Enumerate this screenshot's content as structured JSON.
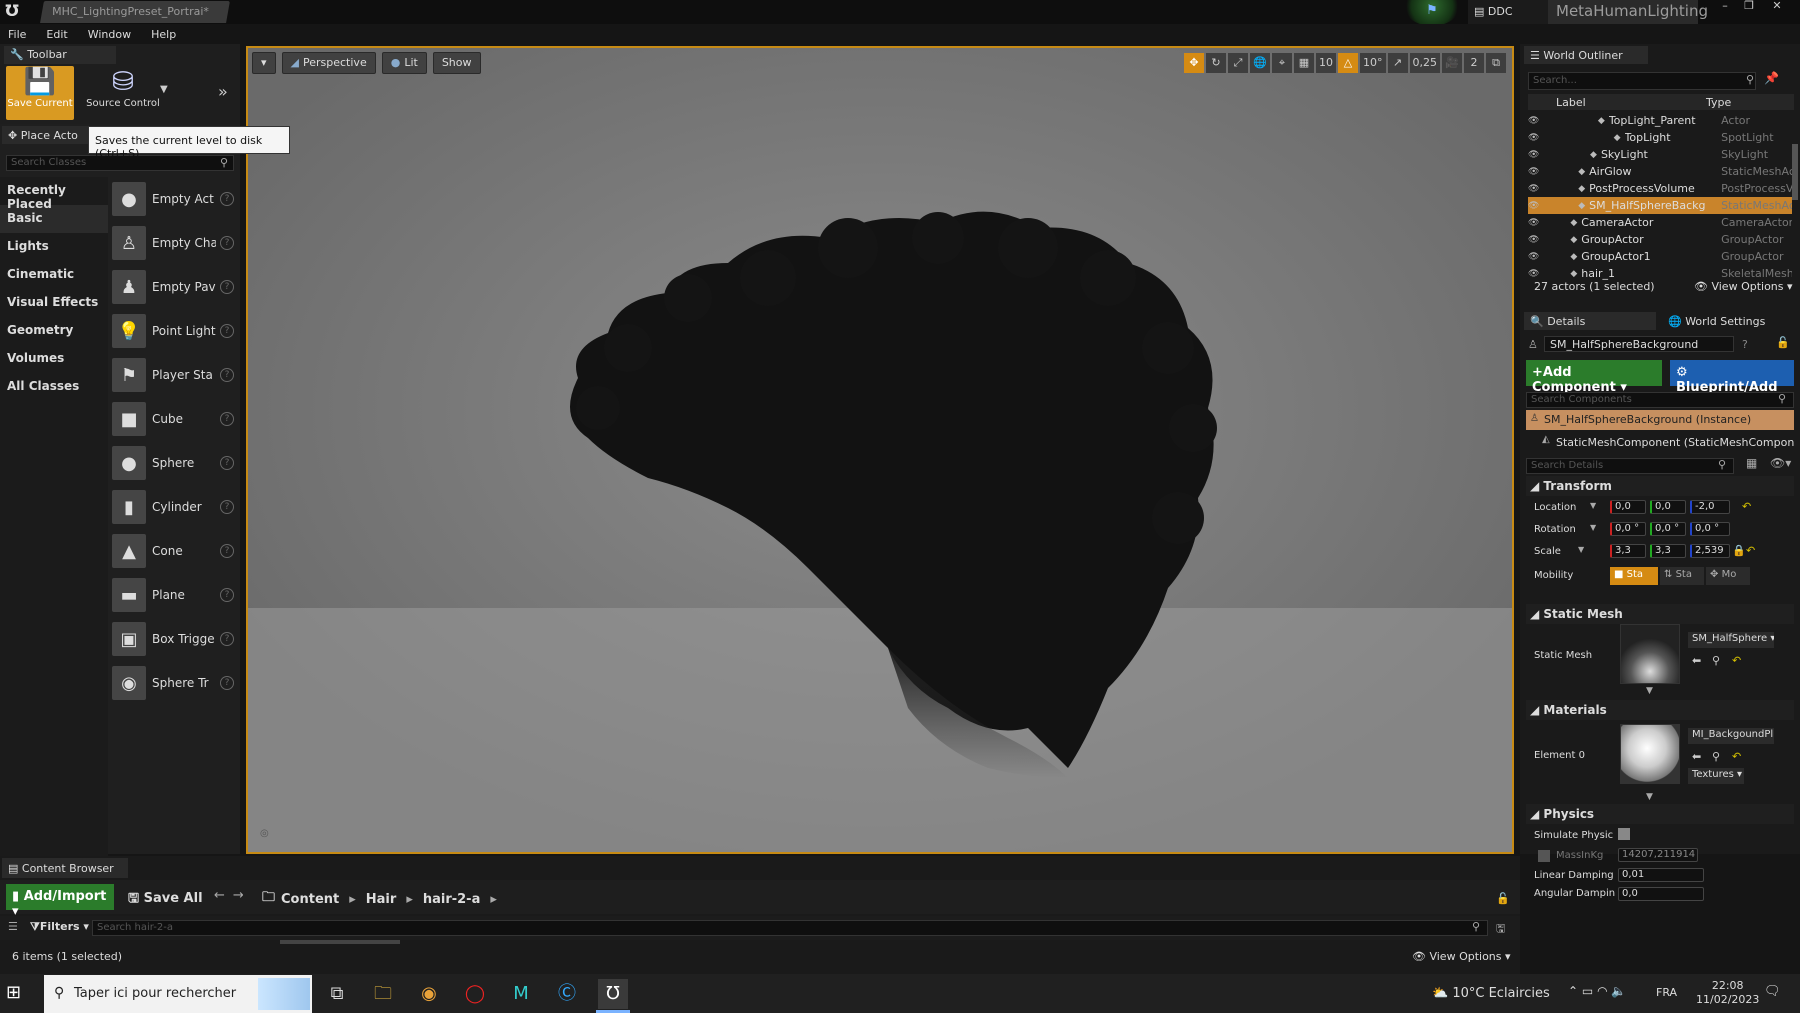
{
  "window": {
    "doc_tab": "MHC_LightingPreset_Portrai*",
    "ddc_label": "DDC",
    "project_name": "MetaHumanLighting",
    "controls": [
      "–",
      "❐",
      "✕"
    ]
  },
  "menu": [
    "File",
    "Edit",
    "Window",
    "Help"
  ],
  "toolbar": {
    "tab_label": "Toolbar",
    "save_label": "Save Current",
    "source_control_label": "Source Control",
    "tooltip": "Saves the current level to disk (Ctrl+S)"
  },
  "place_actors": {
    "tab_label": "Place Acto",
    "search_placeholder": "Search Classes",
    "categories": [
      "Recently Placed",
      "Basic",
      "Lights",
      "Cinematic",
      "Visual Effects",
      "Geometry",
      "Volumes",
      "All Classes"
    ],
    "selected_category": "Basic",
    "items": [
      {
        "label": "Empty Act",
        "icon": "●"
      },
      {
        "label": "Empty Cha",
        "icon": "♙"
      },
      {
        "label": "Empty Pav",
        "icon": "♟"
      },
      {
        "label": "Point Light",
        "icon": "💡"
      },
      {
        "label": "Player Sta",
        "icon": "⚑"
      },
      {
        "label": "Cube",
        "icon": "■"
      },
      {
        "label": "Sphere",
        "icon": "●"
      },
      {
        "label": "Cylinder",
        "icon": "▮"
      },
      {
        "label": "Cone",
        "icon": "▲"
      },
      {
        "label": "Plane",
        "icon": "▬"
      },
      {
        "label": "Box Trigge",
        "icon": "▣"
      },
      {
        "label": "Sphere Tr",
        "icon": "◉"
      }
    ]
  },
  "viewport": {
    "perspective": "Perspective",
    "lit": "Lit",
    "show": "Show",
    "grid_snap": "10",
    "rot_snap": "10°",
    "scale_snap": "0,25",
    "cam_speed": "2"
  },
  "outliner": {
    "tab_label": "World Outliner",
    "search_placeholder": "Search...",
    "col_label": "Label",
    "col_type": "Type",
    "rows": [
      {
        "label": "TopLight_Parent",
        "type": "Actor"
      },
      {
        "label": "TopLight",
        "type": "SpotLight"
      },
      {
        "label": "SkyLight",
        "type": "SkyLight"
      },
      {
        "label": "AirGlow",
        "type": "StaticMeshAc"
      },
      {
        "label": "PostProcessVolume",
        "type": "PostProcessV"
      },
      {
        "label": "SM_HalfSphereBackg",
        "type": "StaticMeshAc"
      },
      {
        "label": "CameraActor",
        "type": "CameraActor"
      },
      {
        "label": "GroupActor",
        "type": "GroupActor"
      },
      {
        "label": "GroupActor1",
        "type": "GroupActor"
      },
      {
        "label": "hair_1",
        "type": "SkeletalMesh"
      }
    ],
    "selected_index": 5,
    "status": "27 actors (1 selected)",
    "view_options": "View Options"
  },
  "details": {
    "tab_label": "Details",
    "world_settings_label": "World Settings",
    "object_name": "SM_HalfSphereBackground",
    "add_component": "Add Component",
    "blueprint": "Blueprint/Add",
    "components_search_placeholder": "Search Components",
    "instance_label": "SM_HalfSphereBackground (Instance)",
    "static_mesh_component": "StaticMeshComponent (StaticMeshComponent",
    "details_search_placeholder": "Search Details",
    "transform": {
      "section": "Transform",
      "location_label": "Location",
      "rotation_label": "Rotation",
      "scale_label": "Scale",
      "mobility_label": "Mobility",
      "location": [
        "0,0",
        "0,0",
        "-2,0"
      ],
      "rotation": [
        "0,0 °",
        "0,0 °",
        "0,0 °"
      ],
      "scale": [
        "3,3",
        "3,3",
        "2,539"
      ],
      "mobility": [
        "Sta",
        "Sta",
        "Mo"
      ]
    },
    "static_mesh": {
      "section": "Static Mesh",
      "label": "Static Mesh",
      "value": "SM_HalfSphere"
    },
    "materials": {
      "section": "Materials",
      "label": "Element 0",
      "value": "MI_BackgoundPl",
      "textures": "Textures"
    },
    "physics": {
      "section": "Physics",
      "simulate_label": "Simulate Physic",
      "mass_label": "MassInKg",
      "mass_value": "14207,211914",
      "linear_label": "Linear Damping",
      "linear_value": "0,01",
      "angular_label": "Angular Dampin",
      "angular_value": "0,0"
    }
  },
  "content_browser": {
    "tab_label": "Content Browser",
    "add_import": "Add/Import",
    "save_all": "Save All",
    "breadcrumb": [
      "Content",
      "Hair",
      "hair-2-a"
    ],
    "filters": "Filters",
    "search_placeholder": "Search hair-2-a",
    "status": "6 items (1 selected)",
    "view_options": "View Options"
  },
  "taskbar": {
    "search_placeholder": "Taper ici pour rechercher",
    "weather": "10°C  Eclaircies",
    "lang": "FRA",
    "time": "22:08",
    "date": "11/02/2023"
  },
  "colors": {
    "accent_orange": "#d99a22",
    "add_green": "#2b7c2b",
    "blueprint_blue": "#1d5fb0",
    "selection": "#c9842b"
  }
}
